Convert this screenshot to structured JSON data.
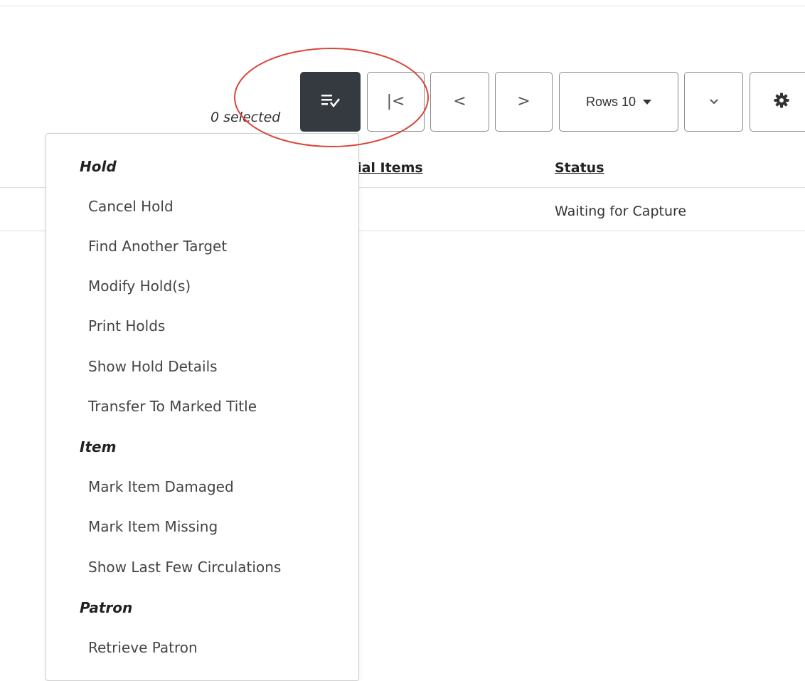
{
  "toolbar": {
    "selected_count": "0 selected",
    "rows_label": "Rows 10",
    "actions_icon": "list-check-icon",
    "first_page_glyph": "|<",
    "prev_page_glyph": "<",
    "next_page_glyph": ">",
    "expand_glyph": "chevron-down-icon",
    "settings_icon": "gear-icon"
  },
  "table": {
    "columns": [
      "tial Items",
      "Status"
    ],
    "rows": [
      {
        "status": "Waiting for Capture"
      }
    ]
  },
  "menu": {
    "sections": [
      {
        "header": "Hold",
        "items": [
          "Cancel Hold",
          "Find Another Target",
          "Modify Hold(s)",
          "Print Holds",
          "Show Hold Details",
          "Transfer To Marked Title"
        ]
      },
      {
        "header": "Item",
        "items": [
          "Mark Item Damaged",
          "Mark Item Missing",
          "Show Last Few Circulations"
        ]
      },
      {
        "header": "Patron",
        "items": [
          "Retrieve Patron"
        ]
      }
    ]
  },
  "colors": {
    "dark_button": "#343a40",
    "annotation_circle": "#d9463a"
  }
}
